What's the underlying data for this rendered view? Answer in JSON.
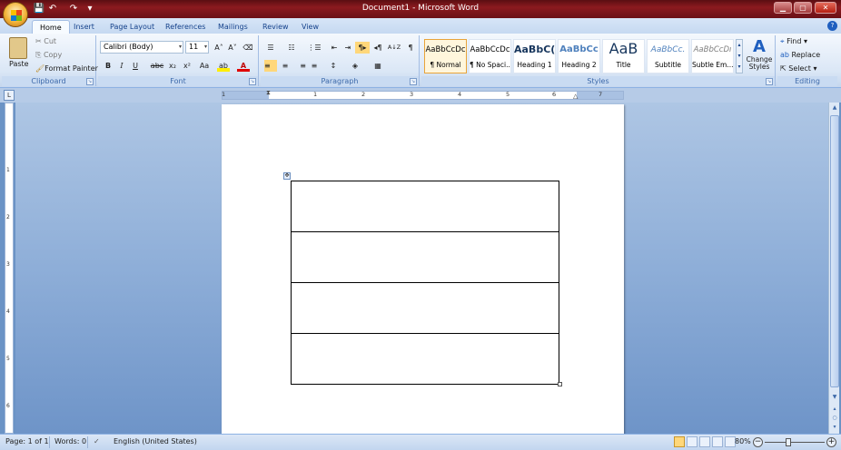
{
  "window": {
    "title": "Document1 - Microsoft Word",
    "controls": {
      "minimize": "▁",
      "maximize": "▢",
      "close": "✕"
    }
  },
  "quick_access": {
    "save": "💾",
    "undo": "↶",
    "redo": "↷",
    "more": "▾"
  },
  "tabs": [
    "Home",
    "Insert",
    "Page Layout",
    "References",
    "Mailings",
    "Review",
    "View"
  ],
  "active_tab": "Home",
  "help": "?",
  "clipboard": {
    "paste": "Paste",
    "cut": "Cut",
    "copy": "Copy",
    "format_painter": "Format Painter",
    "label": "Clipboard"
  },
  "font": {
    "family": "Calibri (Body)",
    "size": "11",
    "grow": "A˄",
    "shrink": "A˅",
    "clear": "⌫",
    "bold": "B",
    "italic": "I",
    "underline": "U",
    "strikethrough": "abc",
    "subscript": "x₂",
    "superscript": "x²",
    "change_case": "Aa",
    "highlight": "ab",
    "font_color": "A",
    "label": "Font"
  },
  "paragraph": {
    "bullets": "☰",
    "numbering": "☷",
    "multilevel": "⋮☰",
    "decrease_indent": "⇤",
    "increase_indent": "⇥",
    "ltr": "¶▸",
    "rtl": "◂¶",
    "sort": "A↓Z",
    "show_marks": "¶",
    "align_left": "≡",
    "center": "≡",
    "align_right": "≡",
    "justify": "≡",
    "line_spacing": "↕",
    "shading": "◈",
    "borders": "▦",
    "label": "Paragraph"
  },
  "styles": {
    "items": [
      {
        "sample": "AaBbCcDc",
        "name": "¶ Normal"
      },
      {
        "sample": "AaBbCcDc",
        "name": "¶ No Spaci..."
      },
      {
        "sample": "AaBbC(",
        "name": "Heading 1"
      },
      {
        "sample": "AaBbCc",
        "name": "Heading 2"
      },
      {
        "sample": "AaB",
        "name": "Title"
      },
      {
        "sample": "AaBbCc.",
        "name": "Subtitle"
      },
      {
        "sample": "AaBbCcDı",
        "name": "Subtle Em..."
      }
    ],
    "change_styles": "Change Styles",
    "label": "Styles"
  },
  "editing": {
    "find": "Find",
    "replace": "Replace",
    "select": "Select",
    "label": "Editing"
  },
  "ruler_numbers": [
    "1",
    "1",
    "2",
    "3",
    "4",
    "5",
    "6",
    "7"
  ],
  "vruler_numbers": [
    "1",
    "2",
    "3",
    "4",
    "5",
    "6"
  ],
  "document": {
    "table_rows": 4,
    "table_cols": 1
  },
  "statusbar": {
    "page": "Page: 1 of 1",
    "words": "Words: 0",
    "language": "English (United States)",
    "zoom": "80%",
    "zoom_level_percent": 80
  },
  "colors": {
    "titlebar": "#8b1a1f",
    "workspace": "#8eaed8",
    "accent": "#15428b",
    "selected_style": "#e8a43a"
  }
}
